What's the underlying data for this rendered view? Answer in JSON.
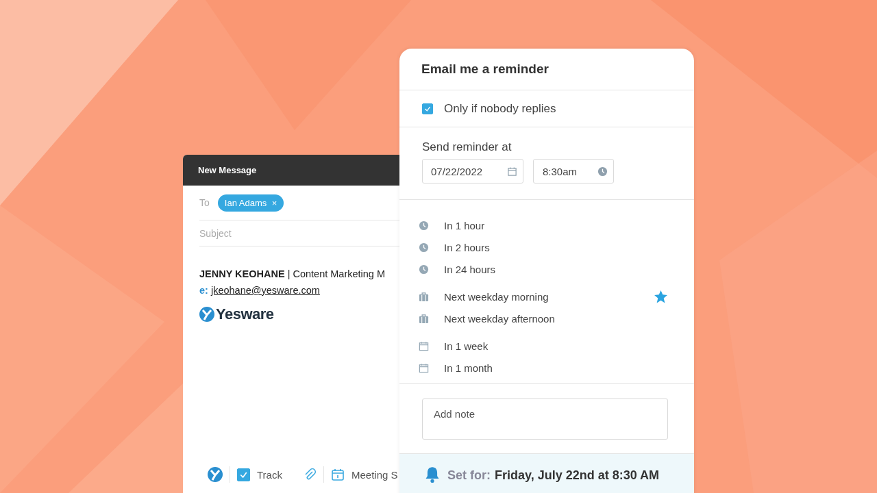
{
  "compose": {
    "title": "New Message",
    "to_label": "To",
    "recipient": "Ian Adams",
    "remove_icon": "×",
    "subject_placeholder": "Subject",
    "signature": {
      "name": "JENNY KEOHANE",
      "separator": "|",
      "role": "Content Marketing M",
      "email_label": "e:",
      "email": "jkeohane@yesware.com"
    },
    "logo_text": "Yesware",
    "toolbar": {
      "track": {
        "label": "Track",
        "checked": true
      },
      "meeting_label": "Meeting S"
    }
  },
  "reminder": {
    "title": "Email me a reminder",
    "only_if_no_reply": {
      "label": "Only if nobody replies",
      "checked": true
    },
    "send_at_label": "Send reminder at",
    "date": "07/22/2022",
    "time": "8:30am",
    "options": [
      {
        "label": "In 1 hour",
        "kind": "clock",
        "starred": false
      },
      {
        "label": "In 2 hours",
        "kind": "clock",
        "starred": false
      },
      {
        "label": "In 24 hours",
        "kind": "clock",
        "starred": false
      },
      {
        "label": "Next weekday morning",
        "kind": "briefcase",
        "starred": true
      },
      {
        "label": "Next weekday afternoon",
        "kind": "briefcase",
        "starred": false
      },
      {
        "label": "In 1 week",
        "kind": "calendar",
        "starred": false
      },
      {
        "label": "In 1 month",
        "kind": "calendar",
        "starred": false
      }
    ],
    "note_placeholder": "Add note",
    "set_for_label": "Set for:",
    "set_for_value": "Friday, July 22nd at 8:30 AM"
  }
}
